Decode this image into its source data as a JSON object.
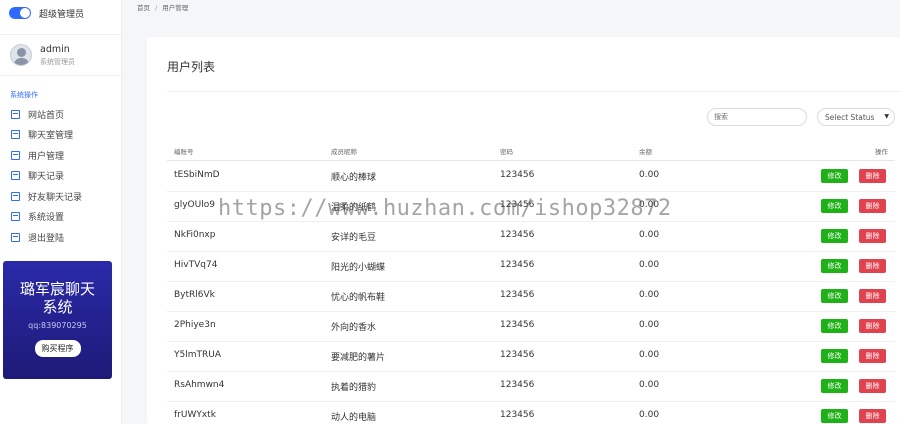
{
  "app": {
    "brand_title": "超级管理员"
  },
  "user": {
    "name": "admin",
    "role": "系统管理员"
  },
  "sidebar": {
    "section": "系统操作",
    "items": [
      {
        "label": "网站首页"
      },
      {
        "label": "聊天室管理"
      },
      {
        "label": "用户管理"
      },
      {
        "label": "聊天记录"
      },
      {
        "label": "好友聊天记录"
      },
      {
        "label": "系统设置"
      },
      {
        "label": "退出登陆"
      }
    ]
  },
  "promo": {
    "title": "璐军宸聊天系统",
    "qq": "qq:839070295",
    "button": "购买程序"
  },
  "breadcrumb": {
    "home": "首页",
    "sep": "/",
    "current": "用户管理"
  },
  "page": {
    "title": "用户列表"
  },
  "filters": {
    "search_placeholder": "搜索",
    "status_value": "Select Status"
  },
  "table": {
    "columns": [
      "编账号",
      "成员昵称",
      "密码",
      "余额",
      "操作"
    ],
    "rows": [
      {
        "account": "tESbiNmD",
        "nickname": "顺心的棒球",
        "password": "123456",
        "balance": "0.00"
      },
      {
        "account": "glyOUlo9",
        "nickname": "温柔的纸鹤",
        "password": "123456",
        "balance": "0.00"
      },
      {
        "account": "NkFi0nxp",
        "nickname": "安详的毛豆",
        "password": "123456",
        "balance": "0.00"
      },
      {
        "account": "HivTVq74",
        "nickname": "阳光的小蝴蝶",
        "password": "123456",
        "balance": "0.00"
      },
      {
        "account": "BytRl6Vk",
        "nickname": "忧心的帆布鞋",
        "password": "123456",
        "balance": "0.00"
      },
      {
        "account": "2Phiye3n",
        "nickname": "外向的香水",
        "password": "123456",
        "balance": "0.00"
      },
      {
        "account": "Y5lmTRUA",
        "nickname": "要减肥的薯片",
        "password": "123456",
        "balance": "0.00"
      },
      {
        "account": "RsAhmwn4",
        "nickname": "执着的猎豹",
        "password": "123456",
        "balance": "0.00"
      },
      {
        "account": "frUWYxtk",
        "nickname": "动人的电脑",
        "password": "123456",
        "balance": "0.00"
      }
    ],
    "edit_label": "修改",
    "delete_label": "删除"
  },
  "watermark": "https://www.huzhan.com/ishop32872",
  "colors": {
    "accent": "#2f6bff",
    "edit": "#1fb118",
    "delete": "#e0424e",
    "promo": "#2a2aa8"
  }
}
